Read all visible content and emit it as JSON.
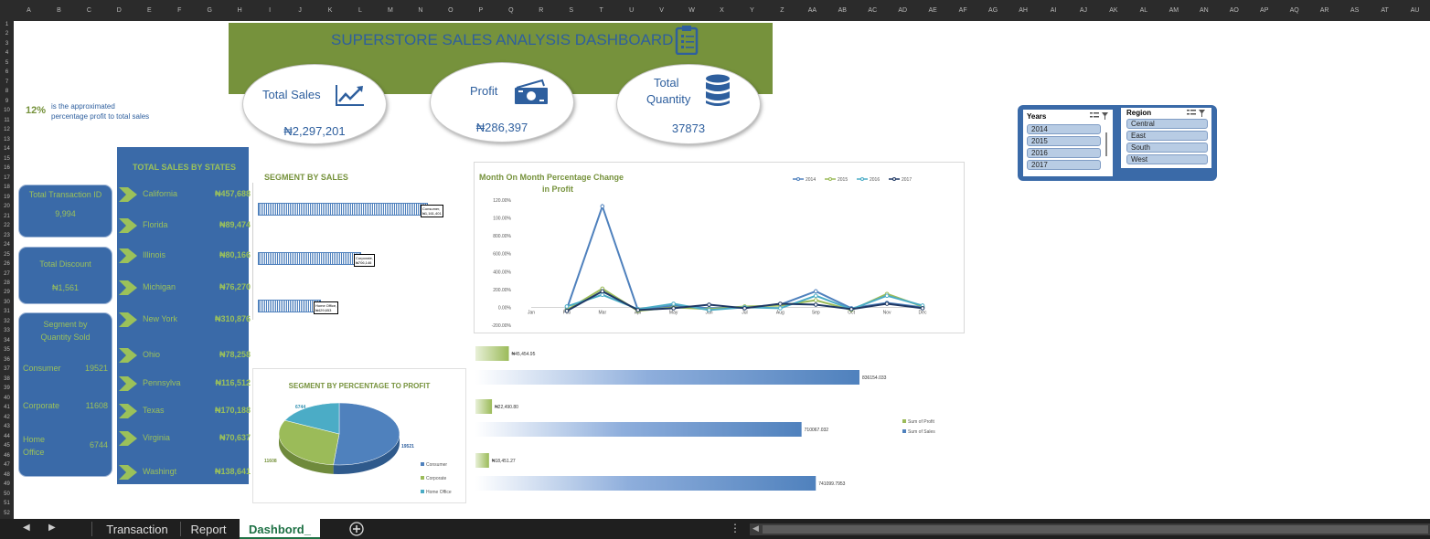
{
  "sheet_columns": [
    "A",
    "B",
    "C",
    "D",
    "E",
    "F",
    "G",
    "H",
    "I",
    "J",
    "K",
    "L",
    "M",
    "N",
    "O",
    "P",
    "Q",
    "R",
    "S",
    "T",
    "U",
    "V",
    "W",
    "X",
    "Y",
    "Z",
    "AA",
    "AB",
    "AC",
    "AD",
    "AE",
    "AF",
    "AG",
    "AH",
    "AI",
    "AJ",
    "AK",
    "AL",
    "AM",
    "AN",
    "AO",
    "AP",
    "AQ",
    "AR",
    "AS",
    "AT",
    "AU"
  ],
  "sheet_rows": [
    "1",
    "2",
    "3",
    "4",
    "5",
    "6",
    "7",
    "8",
    "9",
    "10",
    "11",
    "12",
    "13",
    "14",
    "15",
    "16",
    "17",
    "18",
    "19",
    "20",
    "21",
    "22",
    "23",
    "24",
    "25",
    "26",
    "27",
    "28",
    "29",
    "30",
    "31",
    "32",
    "33",
    "34",
    "35",
    "36",
    "37",
    "38",
    "39",
    "40",
    "41",
    "42",
    "43",
    "44",
    "45",
    "46",
    "47",
    "48",
    "49",
    "50",
    "51",
    "52"
  ],
  "dashboard": {
    "title": "SUPERSTORE SALES ANALYSIS DASHBOARD",
    "kpis": {
      "total_sales": {
        "label": "Total Sales",
        "value": "₦2,297,201"
      },
      "profit": {
        "label": "Profit",
        "value": "₦286,397"
      },
      "total_quantity": {
        "label_line1": "Total",
        "label_line2": "Quantity",
        "value": "37873"
      }
    },
    "percent_note": {
      "value": "12%",
      "text_line1": "is the approximated",
      "text_line2": "percentage profit to total sales"
    },
    "left_boxes": {
      "transaction": {
        "label": "Total Transaction ID",
        "value": "9,994"
      },
      "discount": {
        "label": "Total Discount",
        "value": "₦1,561"
      },
      "segment_qty": {
        "title_line1": "Segment by",
        "title_line2": "Quantity Sold",
        "rows": [
          {
            "name": "Consumer",
            "value": "19521"
          },
          {
            "name": "Corporate",
            "value": "11608"
          },
          {
            "name_line1": "Home",
            "name_line2": "Office",
            "value": "6744"
          }
        ]
      }
    },
    "states": {
      "title": "TOTAL SALES BY STATES",
      "rows": [
        {
          "name": "California",
          "value": "₦457,688"
        },
        {
          "name": "Florida",
          "value": "₦89,474"
        },
        {
          "name": "Illinois",
          "value": "₦80,166"
        },
        {
          "name": "Michigan",
          "value": "₦76,270"
        },
        {
          "name": "New York",
          "value": "₦310,876"
        },
        {
          "name": "Ohio",
          "value": "₦78,258"
        },
        {
          "name": "Pennsylva",
          "value": "₦116,512"
        },
        {
          "name": "Texas",
          "value": "₦170,188"
        },
        {
          "name": "Virginia",
          "value": "₦70,637"
        },
        {
          "name": "Washingt",
          "value": "₦138,641"
        }
      ]
    },
    "segment_by_sales": {
      "title": "SEGMENT BY SALES"
    },
    "pie_title": "SEGMENT BY PERCENTAGE TO PROFIT",
    "slicers": {
      "years": {
        "title": "Years",
        "items": [
          "2014",
          "2015",
          "2016",
          "2017"
        ]
      },
      "region": {
        "title": "Region",
        "items": [
          "Central",
          "East",
          "South",
          "West"
        ]
      }
    }
  },
  "chart_data": [
    {
      "type": "bar",
      "orientation": "horizontal",
      "title": "SEGMENT BY SALES",
      "categories": [
        "Consumer",
        "Corporate",
        "Home Office"
      ],
      "values": [
        1161401,
        706146,
        429653
      ],
      "labels": [
        "Consumer, ₦1,161,401",
        "Corporate, ₦706,146",
        "Home Office, ₦429,653"
      ]
    },
    {
      "type": "line",
      "title_line1": "Month On Month  Percentage Change",
      "title_line2": "in Profit",
      "x": [
        "Jan",
        "Feb",
        "Mar",
        "Apr",
        "May",
        "Jun",
        "Jul",
        "Aug",
        "Sep",
        "Oct",
        "Nov",
        "Dec"
      ],
      "y_ticks": [
        "120.00%",
        "100.00%",
        "800.00%",
        "600.00%",
        "400.00%",
        "200.00%",
        "0.00%",
        "-200.00%"
      ],
      "ylim": [
        -200,
        1200
      ],
      "legend": "top-right",
      "series": [
        {
          "name": "2014",
          "color": "#4f81bd",
          "values": [
            null,
            -20,
            1130,
            -30,
            20,
            -10,
            0,
            30,
            180,
            -10,
            50,
            0
          ]
        },
        {
          "name": "2015",
          "color": "#9bbb59",
          "values": [
            null,
            -30,
            210,
            -40,
            0,
            -20,
            10,
            20,
            80,
            -30,
            150,
            10
          ]
        },
        {
          "name": "2016",
          "color": "#4bacc6",
          "values": [
            null,
            10,
            140,
            -20,
            40,
            -30,
            0,
            -10,
            130,
            -20,
            130,
            20
          ]
        },
        {
          "name": "2017",
          "color": "#1f3864",
          "values": [
            null,
            -40,
            180,
            -30,
            -10,
            30,
            -10,
            40,
            30,
            -20,
            40,
            -10
          ]
        }
      ]
    },
    {
      "type": "pie",
      "title": "SEGMENT BY PERCENTAGE TO PROFIT",
      "categories": [
        "Consumer",
        "Corporate",
        "Home Office"
      ],
      "values": [
        19521,
        11608,
        6744
      ],
      "colors": [
        "#4f81bd",
        "#9bbb59",
        "#4bacc6"
      ],
      "labels": [
        "19521",
        "11608",
        "6744"
      ]
    },
    {
      "type": "bar",
      "orientation": "horizontal",
      "series": [
        {
          "name": "Sum of Profit",
          "color": "#9bbb59",
          "values": [
            45454.95,
            22490.8,
            18451.27
          ],
          "labels": [
            "₦45,454.95",
            "₦22,490.80",
            "₦18,451.27"
          ]
        },
        {
          "name": "Sum of Sales",
          "color": "#4f81bd",
          "values": [
            836154.033,
            710067.032,
            741099.7953
          ],
          "labels": [
            "836154.033",
            "710067.032",
            "741099.7953"
          ]
        }
      ],
      "legend": "right"
    }
  ],
  "tabs": {
    "items": [
      "Transaction",
      "Report",
      "Dashbord_"
    ],
    "active": "Dashbord_"
  },
  "colors": {
    "green": "#76923c",
    "blue": "#3a6aa8",
    "title_blue": "#2e5f9e",
    "light_green": "#9bc15a"
  }
}
